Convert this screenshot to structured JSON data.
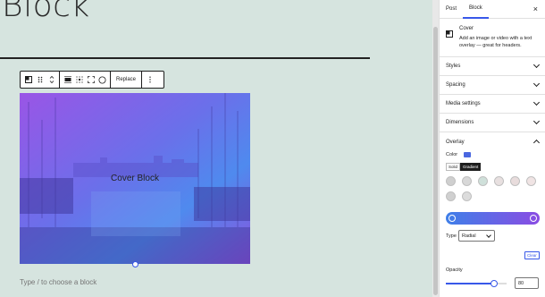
{
  "editor": {
    "title": "Block",
    "cover_title": "Cover Block",
    "placeholder": "Type / to choose a block",
    "toolbar": {
      "replace_label": "Replace",
      "icons": [
        "cover-block-icon",
        "drag-handle-icon",
        "move-up-down-icon",
        "align-icon",
        "grid-position-icon",
        "fullscreen-icon",
        "circle-icon",
        "more-options-icon"
      ]
    }
  },
  "sidebar": {
    "tabs": [
      {
        "label": "Post",
        "active": false
      },
      {
        "label": "Block",
        "active": true
      }
    ],
    "close_label": "×",
    "block": {
      "name": "Cover",
      "description": "Add an image or video with a text overlay — great for headers."
    },
    "panels": [
      {
        "label": "Styles"
      },
      {
        "label": "Spacing"
      },
      {
        "label": "Media settings"
      },
      {
        "label": "Dimensions"
      },
      {
        "label": "Overlay"
      }
    ],
    "overlay": {
      "color_label": "Color",
      "color_value": "#4a67e0",
      "tabs": [
        {
          "label": "Solid",
          "active": false
        },
        {
          "label": "Gradient",
          "active": true
        }
      ],
      "swatch_colors": [
        "#cfcfcf",
        "#d8d8d8",
        "#cfe0da",
        "#e8e0e0",
        "#e8dcdc",
        "#f0e4e4",
        "#d0d0d0",
        "#dcdcdc"
      ],
      "gradient": {
        "from": "#3f7fe8",
        "to": "#8a4ce3"
      },
      "type_label": "Type",
      "type_value": "Radial",
      "clear_label": "Clear",
      "opacity_label": "Opacity",
      "opacity_value": "80",
      "opacity_fraction": 0.8
    }
  }
}
